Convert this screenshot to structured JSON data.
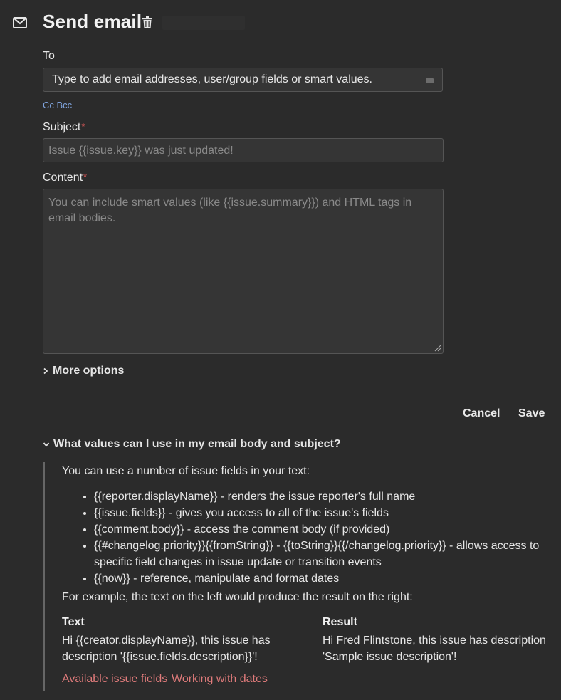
{
  "header": {
    "title": "Send email"
  },
  "to": {
    "label": "To",
    "placeholder": "Type to add email addresses, user/group fields or smart values.",
    "cc_bcc": "Cc Bcc"
  },
  "subject": {
    "label": "Subject",
    "required_mark": "*",
    "placeholder": "Issue {{issue.key}} was just updated!"
  },
  "content": {
    "label": "Content",
    "required_mark": "*",
    "placeholder": "You can include smart values (like {{issue.summary}}) and HTML tags in email bodies."
  },
  "more_options": "More options",
  "actions": {
    "cancel": "Cancel",
    "save": "Save"
  },
  "help": {
    "toggle_label": "What values can I use in my email body and subject?",
    "intro": "You can use a number of issue fields in your text:",
    "items": [
      "{{reporter.displayName}} - renders the issue reporter's full name",
      "{{issue.fields}} - gives you access to all of the issue's fields",
      "{{comment.body}} - access the comment body (if provided)",
      "{{#changelog.priority}}{{fromString}} - {{toString}}{{/changelog.priority}} - allows access to specific field changes in issue update or transition events",
      "{{now}} - reference, manipulate and format dates"
    ],
    "example_intro": "For example, the text on the left would produce the result on the right:",
    "text_heading": "Text",
    "text_example": "Hi {{creator.displayName}}, this issue has description '{{issue.fields.description}}'!",
    "result_heading": "Result",
    "result_example": "Hi Fred Flintstone, this issue has description 'Sample issue description'!",
    "links": [
      "Available issue fields",
      "Working with dates"
    ]
  },
  "colors": {
    "background": "#2b2b2b",
    "link": "#e07b7b",
    "cc_link": "#7fa3dc",
    "required": "#e05a5a"
  }
}
